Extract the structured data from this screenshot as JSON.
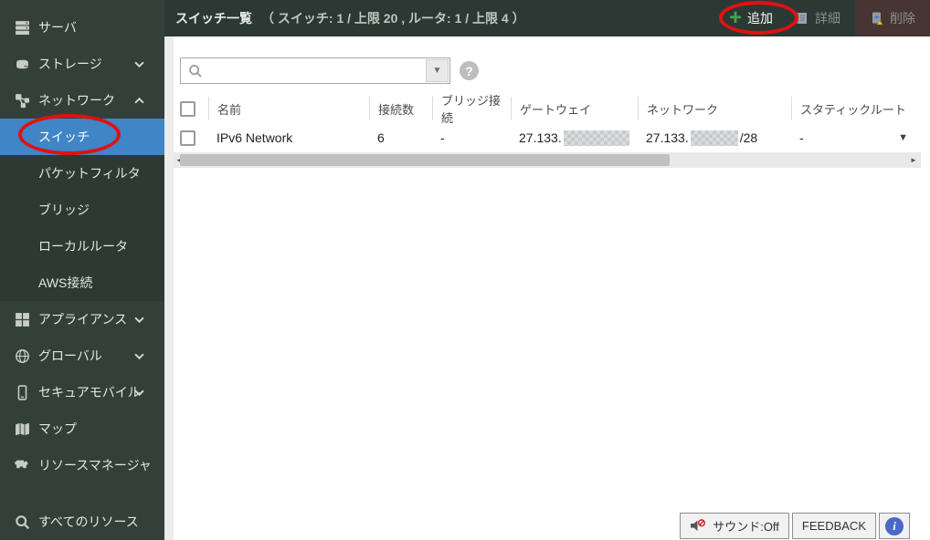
{
  "colors": {
    "selected_blue": "#4085c5",
    "annotation_red": "#e01111",
    "add_green": "#3fa54a",
    "delete_button_bg": "#463531",
    "header_bg": "#2c3833",
    "sidebar_bg": "#33403a"
  },
  "sidebar": {
    "items": [
      {
        "label": "サーバ"
      },
      {
        "label": "ストレージ"
      },
      {
        "label": "ネットワーク"
      },
      {
        "label": "スイッチ"
      },
      {
        "label": "パケットフィルタ"
      },
      {
        "label": "ブリッジ"
      },
      {
        "label": "ローカルルータ"
      },
      {
        "label": "AWS接続"
      },
      {
        "label": "アプライアンス"
      },
      {
        "label": "グローバル"
      },
      {
        "label": "セキュアモバイル"
      },
      {
        "label": "マップ"
      },
      {
        "label": "リソースマネージャ"
      },
      {
        "label": "すべてのリソース"
      }
    ]
  },
  "header": {
    "title": "スイッチ一覧",
    "counts": "（ スイッチ: 1 / 上限 20 ,  ルータ: 1 / 上限 4 ）",
    "add_label": "追加",
    "detail_label": "詳細",
    "delete_label": "削除",
    "plus_glyph": "+"
  },
  "search": {
    "value": "",
    "placeholder": "",
    "dropdown_glyph": "▼",
    "help_glyph": "?"
  },
  "table": {
    "columns": [
      "名前",
      "接続数",
      "ブリッジ接続",
      "ゲートウェイ",
      "ネットワーク",
      "スタティックルート"
    ],
    "row": {
      "name": "IPv6 Network",
      "connections": "6",
      "bridge": "-",
      "gateway_prefix": "27.133.",
      "network_prefix": "27.133.",
      "network_suffix": "/28",
      "static_route": "-",
      "menu_glyph": "▼"
    }
  },
  "scrollbar": {
    "left_glyph": "◄",
    "right_glyph": "►"
  },
  "footer": {
    "sound_label": "サウンド:Off",
    "feedback_label": "FEEDBACK",
    "info_glyph": "i"
  }
}
